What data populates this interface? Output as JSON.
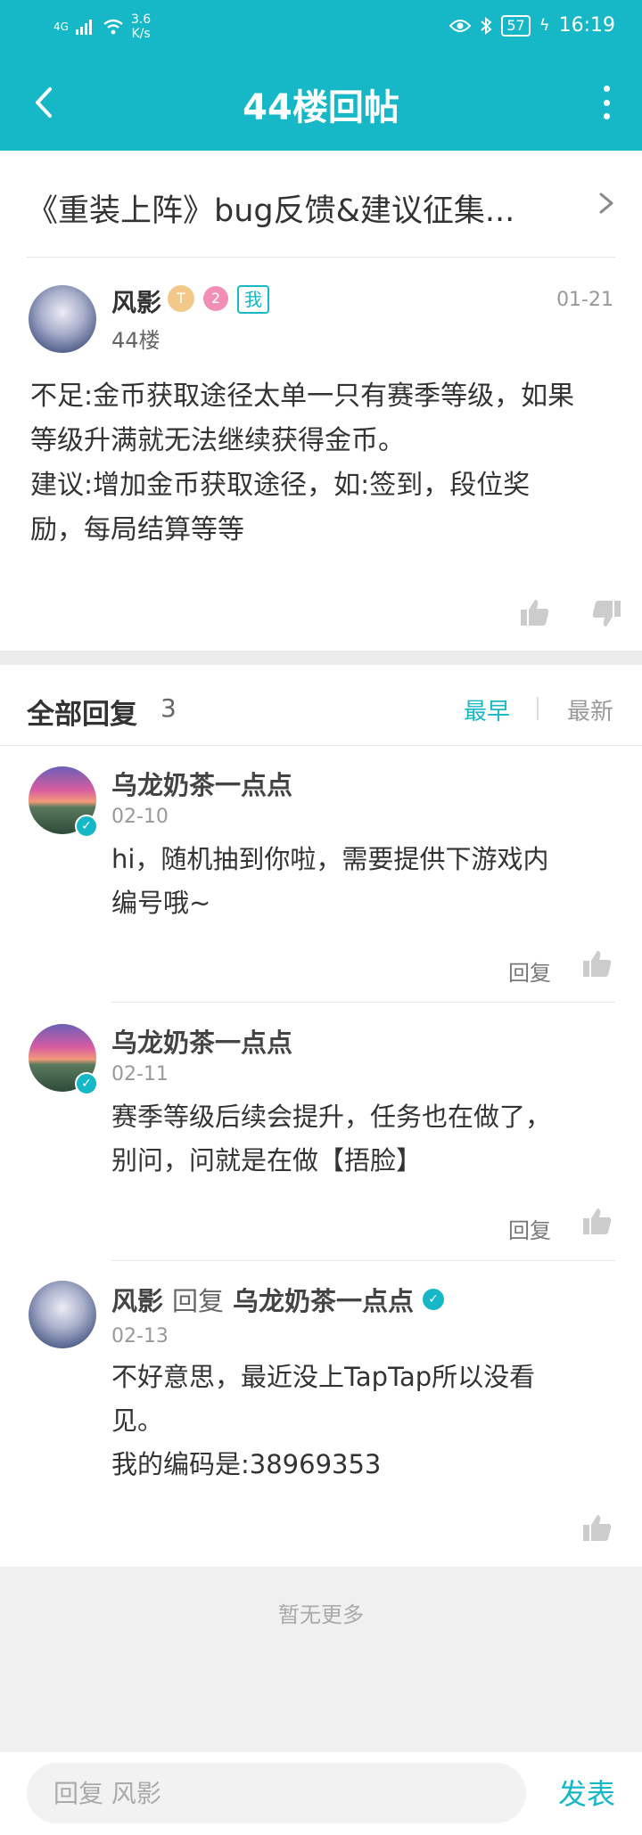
{
  "status_bar": {
    "signal": "4G",
    "speed": "3.6",
    "speed_unit": "K/s",
    "battery": "57",
    "time": "16:19"
  },
  "nav": {
    "title": "44楼回帖"
  },
  "topic": {
    "title": "《重装上阵》bug反馈&建议征集..."
  },
  "post": {
    "author": "风影",
    "badge_t": "T",
    "badge_2": "2",
    "me_tag": "我",
    "date": "01-21",
    "floor": "44楼",
    "lines": [
      "不足:金币获取途径太单一只有赛季等级，如果",
      "等级升满就无法继续获得金币。",
      "建议:增加金币获取途径，如:签到，段位奖",
      "励，每局结算等等"
    ]
  },
  "replies_header": {
    "title": "全部回复",
    "count": "3",
    "sort_earliest": "最早",
    "sort_latest": "最新"
  },
  "replies": [
    {
      "author": "乌龙奶茶一点点",
      "date": "02-10",
      "lines": [
        "hi，随机抽到你啦，需要提供下游戏内",
        "编号哦~"
      ],
      "reply_label": "回复"
    },
    {
      "author": "乌龙奶茶一点点",
      "date": "02-11",
      "lines": [
        "赛季等级后续会提升，任务也在做了，",
        "别问，问就是在做【捂脸】"
      ],
      "reply_label": "回复"
    },
    {
      "author": "风影",
      "reply_word": "回复",
      "target": "乌龙奶茶一点点",
      "date": "02-13",
      "lines": [
        "不好意思，最近没上TapTap所以没看",
        "见。",
        "我的编码是:38969353"
      ]
    }
  ],
  "footer": {
    "no_more": "暂无更多",
    "input_placeholder": "回复 风影",
    "send": "发表"
  },
  "colors": {
    "accent": "#16b7c6",
    "bg_gap": "#ececec"
  }
}
